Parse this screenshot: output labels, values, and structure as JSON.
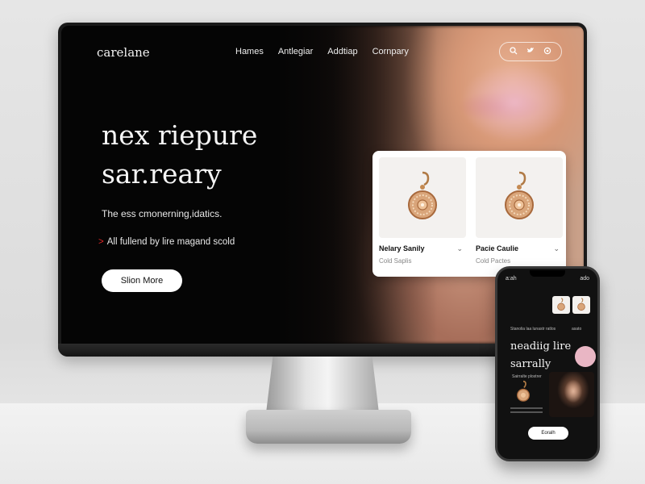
{
  "brand": "carelane",
  "nav": {
    "items": [
      "Hames",
      "Antlegiar",
      "Addtiap",
      "Cornpary"
    ],
    "icons": [
      "search-icon",
      "twitter-icon",
      "settings-icon"
    ]
  },
  "hero": {
    "title_line1": "nex riepure",
    "title_line2": "sar.reary",
    "subtitle": "The ess cmonerning,idatics.",
    "bullet_mark": ">",
    "bullet": "All fullend by lire magand scold",
    "button": "Slion More"
  },
  "products": [
    {
      "name": "Nelary Sanily",
      "subtitle": "Cold Saplis",
      "chevron": "⌄",
      "icon": "earring-icon"
    },
    {
      "name": "Pacie Caulie",
      "subtitle": "Cold Pactes",
      "chevron": "⌄",
      "icon": "earring-icon"
    }
  ],
  "phone": {
    "status_left": "a:ah",
    "status_right": "ado",
    "row_left": "Stanolia laa lunastr ratlos",
    "row_right": "asato",
    "title_line1": "neadiig lire",
    "title_line2": "sarrally",
    "small_text": "Sairralte plostrer",
    "button": "Eoralh"
  },
  "colors": {
    "accent": "#e02828",
    "screen_bg": "#050505",
    "button_bg": "#ffffff",
    "phone_blob": "#e9b6c4"
  }
}
